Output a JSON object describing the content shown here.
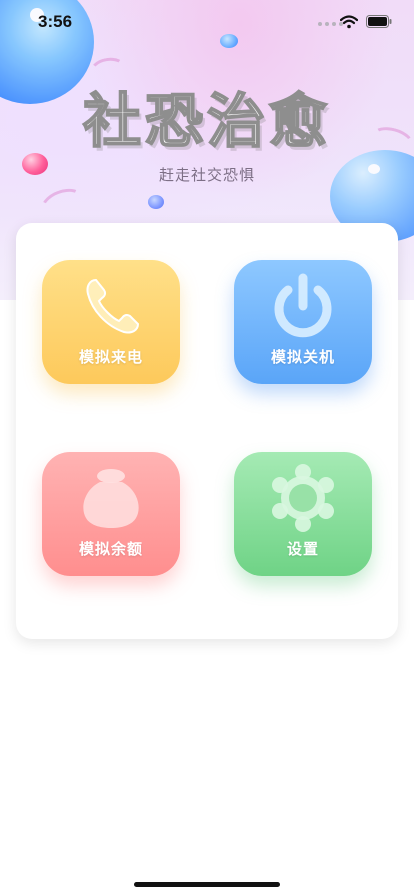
{
  "status_bar": {
    "time": "3:56",
    "icons": [
      "signal-dots-icon",
      "wifi-icon",
      "battery-icon"
    ]
  },
  "header": {
    "title": "社恐治愈",
    "subtitle": "赶走社交恐惧"
  },
  "menu": {
    "items": [
      {
        "label": "模拟来电",
        "icon": "phone-icon",
        "color": "#fdc95b"
      },
      {
        "label": "模拟关机",
        "icon": "power-icon",
        "color": "#5aa5f8"
      },
      {
        "label": "模拟余额",
        "icon": "money-bag-icon",
        "color": "#ff8e8e"
      },
      {
        "label": "设置",
        "icon": "gear-icon",
        "color": "#6fd386"
      }
    ]
  }
}
